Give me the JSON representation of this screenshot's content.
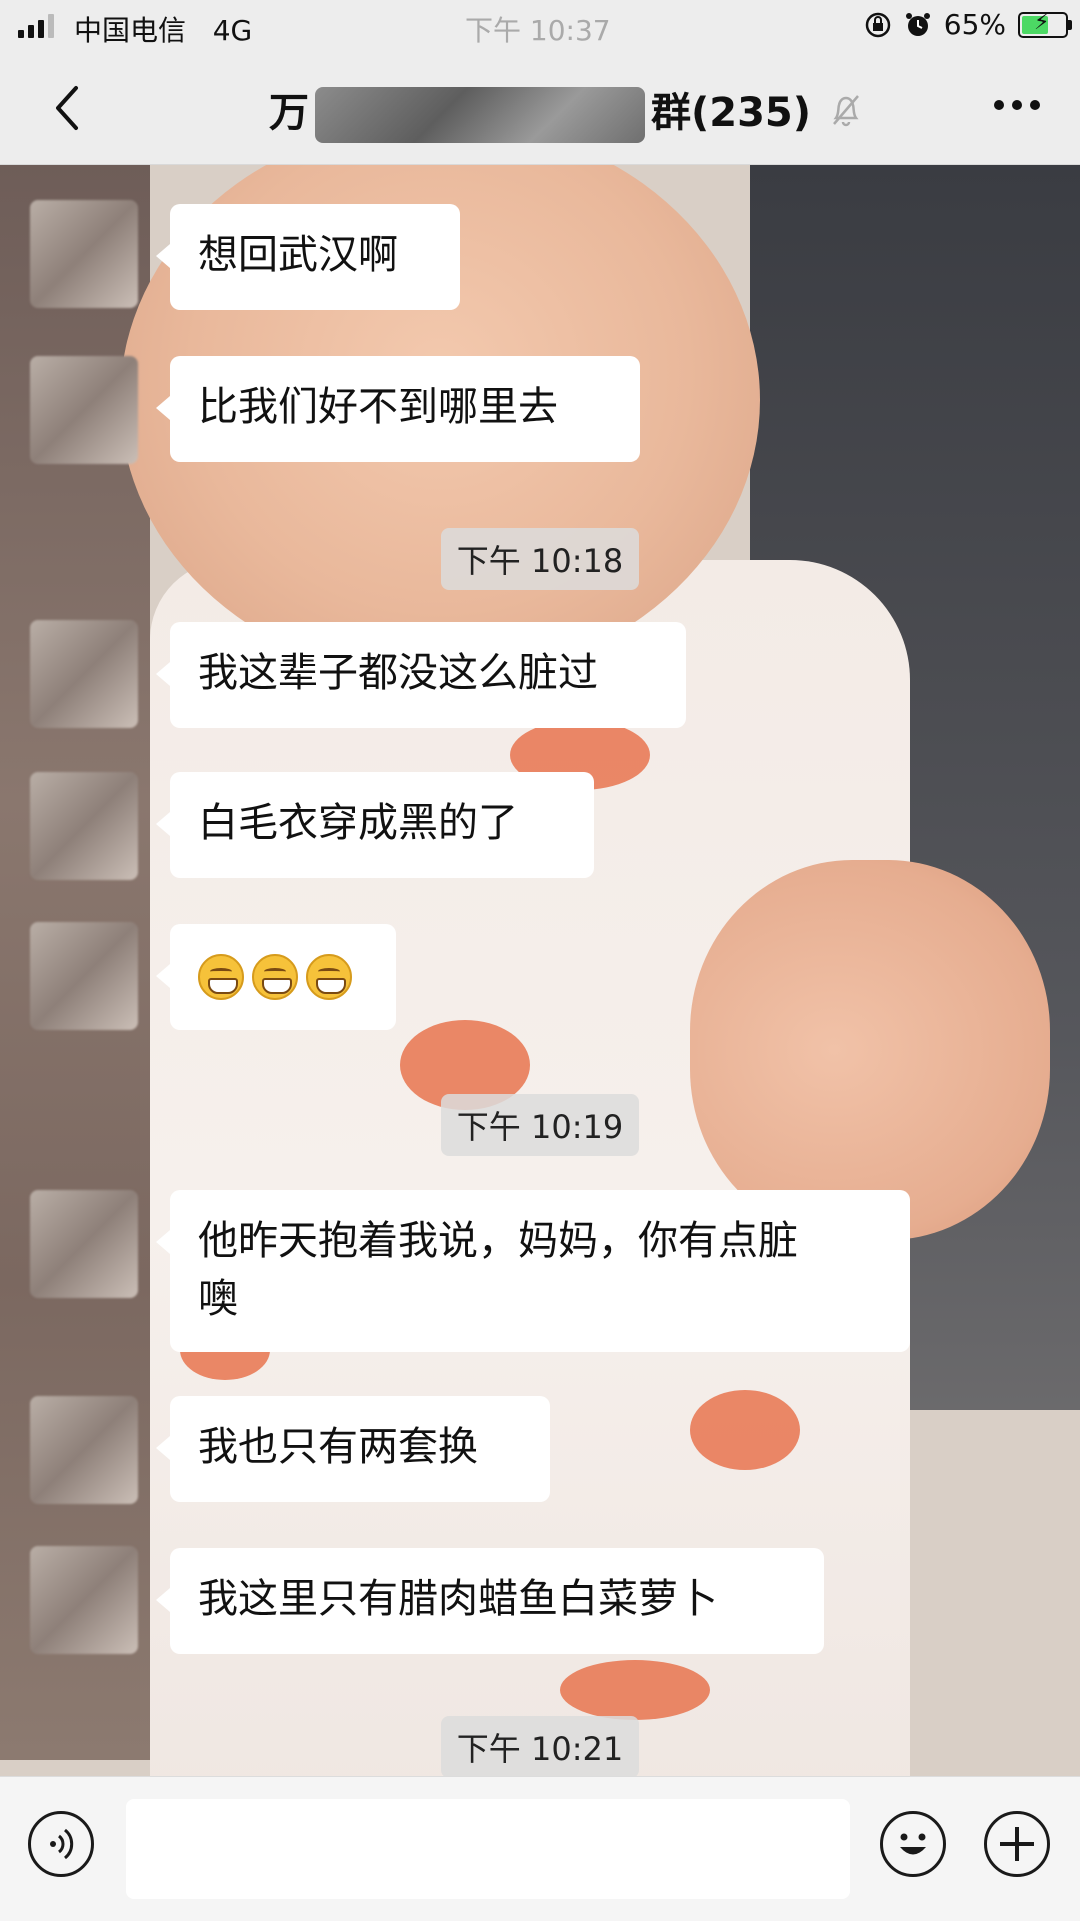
{
  "status_bar": {
    "carrier": "中国电信",
    "network": "4G",
    "time": "下午 10:37",
    "battery_percent": "65%",
    "battery_level": 0.65
  },
  "nav": {
    "title_prefix": "万",
    "title_suffix": "群(235)"
  },
  "messages": [
    {
      "text": "想回武汉啊"
    },
    {
      "text": "比我们好不到哪里去"
    },
    {
      "timestamp": "下午 10:18"
    },
    {
      "text": "我这辈子都没这么脏过"
    },
    {
      "text": "白毛衣穿成黑的了"
    },
    {
      "emoji_count": 3,
      "emoji_name": "grinning-face-icon"
    },
    {
      "timestamp": "下午 10:19"
    },
    {
      "text_line1": "他昨天抱着我说，妈妈，你有点脏",
      "text_line2": "噢"
    },
    {
      "text": "我也只有两套换"
    },
    {
      "text": "我这里只有腊肉蜡鱼白菜萝卜"
    },
    {
      "timestamp": "下午 10:21"
    }
  ],
  "input": {
    "value": ""
  },
  "colors": {
    "bar_bg": "#ededed",
    "bubble_bg": "#ffffff",
    "battery_green": "#4cd964"
  }
}
